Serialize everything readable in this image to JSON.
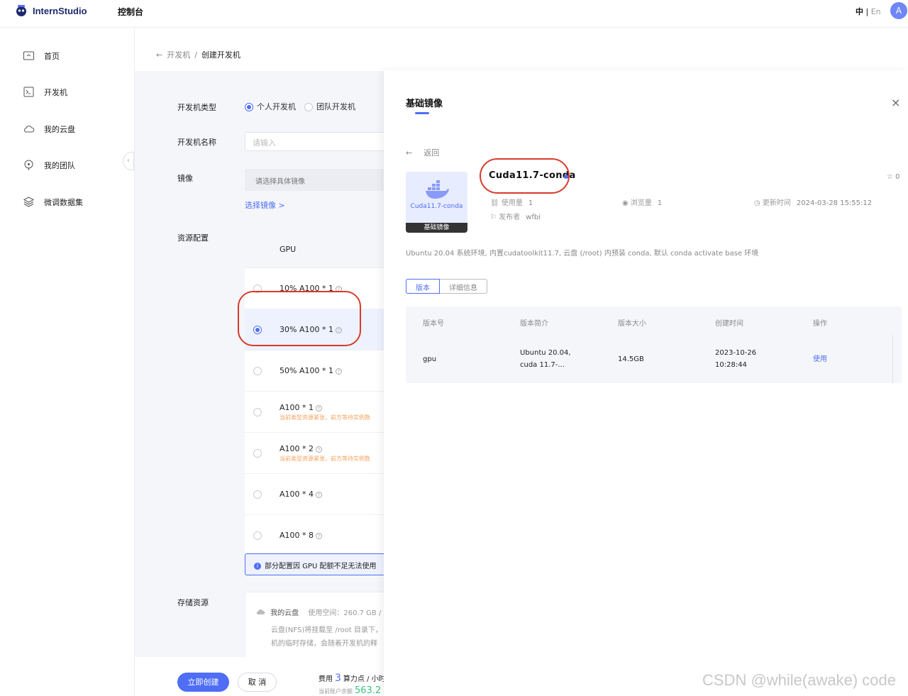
{
  "header": {
    "brand": "InternStudio",
    "console": "控制台",
    "lang_zh": "中",
    "lang_sep": "|",
    "lang_en": "En",
    "avatar": "A"
  },
  "sidebar": {
    "items": [
      {
        "label": "首页",
        "icon": "home-icon"
      },
      {
        "label": "开发机",
        "icon": "terminal-icon"
      },
      {
        "label": "我的云盘",
        "icon": "cloud-icon"
      },
      {
        "label": "我的团队",
        "icon": "team-icon"
      },
      {
        "label": "微调数据集",
        "icon": "layers-icon"
      }
    ],
    "collapse": "‹"
  },
  "breadcrumb": {
    "back_arrow": "←",
    "parent": "开发机",
    "sep": "/",
    "current": "创建开发机"
  },
  "form": {
    "type_label": "开发机类型",
    "type_options": [
      "个人开发机",
      "团队开发机"
    ],
    "name_label": "开发机名称",
    "name_placeholder": "请输入",
    "image_label": "镜像",
    "image_select": "请选择具体镜像",
    "choose_image": "选择镜像 >",
    "resource_label": "资源配置",
    "gpu_header": "GPU",
    "gpu_rows": [
      {
        "name": "10% A100 * 1",
        "warn": ""
      },
      {
        "name": "30% A100 * 1",
        "warn": ""
      },
      {
        "name": "50% A100 * 1",
        "warn": ""
      },
      {
        "name": "A100 * 1",
        "warn": "当前类型资源紧张，前方等待实例数"
      },
      {
        "name": "A100 * 2",
        "warn": "当前类型资源紧张，前方等待实例数"
      },
      {
        "name": "A100 * 4",
        "warn": ""
      },
      {
        "name": "A100 * 8",
        "warn": ""
      }
    ],
    "notice": "部分配置因 GPU 配额不足无法使用",
    "storage_label": "存储资源",
    "storage_name": "我的云盘",
    "storage_used": "使用空间：260.7 GB /",
    "storage_line2": "云盘(NFS)将挂载至 /root 目录下，",
    "storage_line3": "机的临时存储，会随着开发机的释"
  },
  "footer": {
    "create": "立即创建",
    "cancel": "取 消",
    "cost_label": "费用",
    "cost_value": "3",
    "cost_unit": "算力点 / 小时",
    "balance_label": "当前账户余额",
    "balance_value": "563.2"
  },
  "drawer": {
    "title": "基础镜像",
    "close": "×",
    "back": "返回",
    "card_name": "Cuda11.7-conda",
    "card_foot": "基础镜像",
    "image_title": "Cuda11.7-conda",
    "star_count": "0",
    "usage_label": "使用量",
    "usage_value": "1",
    "views_label": "浏览量",
    "views_value": "1",
    "updated_label": "更新时间",
    "updated_value": "2024-03-28 15:55:12",
    "publisher_label": "发布者",
    "publisher_value": "wfbi",
    "description": "Ubuntu 20.04 系统环境, 内置cudatoolkit11.7, 云盘 (/root) 内预装 conda, 默认 conda activate base 环境",
    "tabs": [
      "版本",
      "详细信息"
    ],
    "table_headers": [
      "版本号",
      "版本简介",
      "版本大小",
      "创建时间",
      "操作"
    ],
    "rows": [
      {
        "version": "gpu",
        "intro1": "Ubuntu 20.04,",
        "intro2": "cuda 11.7-...",
        "size": "14.5GB",
        "time1": "2023-10-26",
        "time2": "10:28:44",
        "action": "使用"
      }
    ]
  },
  "watermark": "CSDN @while(awake) code",
  "colors": {
    "accent": "#4f6df5",
    "annotation": "#d93a2b",
    "warn": "#f5a25d"
  }
}
